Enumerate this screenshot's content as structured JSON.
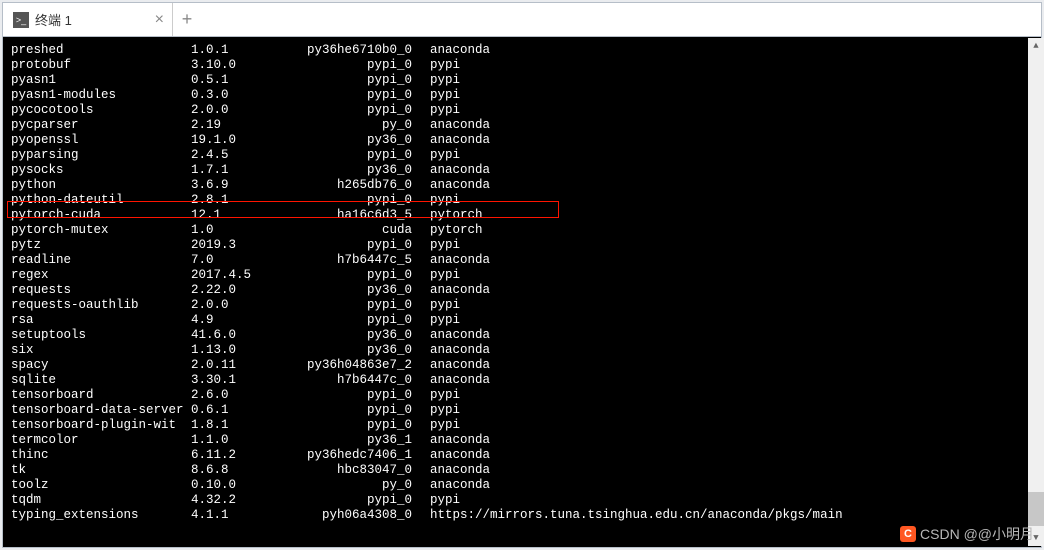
{
  "tab": {
    "title": "终端 1",
    "icon_text": ">_"
  },
  "newtab_glyph": "+",
  "close_glyph": "×",
  "watermark": "CSDN @@小明月",
  "highlight_row_index": 10,
  "packages": [
    {
      "name": "preshed",
      "version": "1.0.1",
      "build": "py36he6710b0_0",
      "channel": "anaconda"
    },
    {
      "name": "protobuf",
      "version": "3.10.0",
      "build": "pypi_0",
      "channel": "pypi"
    },
    {
      "name": "pyasn1",
      "version": "0.5.1",
      "build": "pypi_0",
      "channel": "pypi"
    },
    {
      "name": "pyasn1-modules",
      "version": "0.3.0",
      "build": "pypi_0",
      "channel": "pypi"
    },
    {
      "name": "pycocotools",
      "version": "2.0.0",
      "build": "pypi_0",
      "channel": "pypi"
    },
    {
      "name": "pycparser",
      "version": "2.19",
      "build": "py_0",
      "channel": "anaconda"
    },
    {
      "name": "pyopenssl",
      "version": "19.1.0",
      "build": "py36_0",
      "channel": "anaconda"
    },
    {
      "name": "pyparsing",
      "version": "2.4.5",
      "build": "pypi_0",
      "channel": "pypi"
    },
    {
      "name": "pysocks",
      "version": "1.7.1",
      "build": "py36_0",
      "channel": "anaconda"
    },
    {
      "name": "python",
      "version": "3.6.9",
      "build": "h265db76_0",
      "channel": "anaconda"
    },
    {
      "name": "python-dateutil",
      "version": "2.8.1",
      "build": "pypi_0",
      "channel": "pypi"
    },
    {
      "name": "pytorch-cuda",
      "version": "12.1",
      "build": "ha16c6d3_5",
      "channel": "pytorch"
    },
    {
      "name": "pytorch-mutex",
      "version": "1.0",
      "build": "cuda",
      "channel": "pytorch"
    },
    {
      "name": "pytz",
      "version": "2019.3",
      "build": "pypi_0",
      "channel": "pypi"
    },
    {
      "name": "readline",
      "version": "7.0",
      "build": "h7b6447c_5",
      "channel": "anaconda"
    },
    {
      "name": "regex",
      "version": "2017.4.5",
      "build": "pypi_0",
      "channel": "pypi"
    },
    {
      "name": "requests",
      "version": "2.22.0",
      "build": "py36_0",
      "channel": "anaconda"
    },
    {
      "name": "requests-oauthlib",
      "version": "2.0.0",
      "build": "pypi_0",
      "channel": "pypi"
    },
    {
      "name": "rsa",
      "version": "4.9",
      "build": "pypi_0",
      "channel": "pypi"
    },
    {
      "name": "setuptools",
      "version": "41.6.0",
      "build": "py36_0",
      "channel": "anaconda"
    },
    {
      "name": "six",
      "version": "1.13.0",
      "build": "py36_0",
      "channel": "anaconda"
    },
    {
      "name": "spacy",
      "version": "2.0.11",
      "build": "py36h04863e7_2",
      "channel": "anaconda"
    },
    {
      "name": "sqlite",
      "version": "3.30.1",
      "build": "h7b6447c_0",
      "channel": "anaconda"
    },
    {
      "name": "tensorboard",
      "version": "2.6.0",
      "build": "pypi_0",
      "channel": "pypi"
    },
    {
      "name": "tensorboard-data-server",
      "version": "0.6.1",
      "build": "pypi_0",
      "channel": "pypi"
    },
    {
      "name": "tensorboard-plugin-wit",
      "version": "1.8.1",
      "build": "pypi_0",
      "channel": "pypi"
    },
    {
      "name": "termcolor",
      "version": "1.1.0",
      "build": "py36_1",
      "channel": "anaconda"
    },
    {
      "name": "thinc",
      "version": "6.11.2",
      "build": "py36hedc7406_1",
      "channel": "anaconda"
    },
    {
      "name": "tk",
      "version": "8.6.8",
      "build": "hbc83047_0",
      "channel": "anaconda"
    },
    {
      "name": "toolz",
      "version": "0.10.0",
      "build": "py_0",
      "channel": "anaconda"
    },
    {
      "name": "tqdm",
      "version": "4.32.2",
      "build": "pypi_0",
      "channel": "pypi"
    },
    {
      "name": "typing_extensions",
      "version": "4.1.1",
      "build": "pyh06a4308_0",
      "channel": "https://mirrors.tuna.tsinghua.edu.cn/anaconda/pkgs/main"
    }
  ]
}
